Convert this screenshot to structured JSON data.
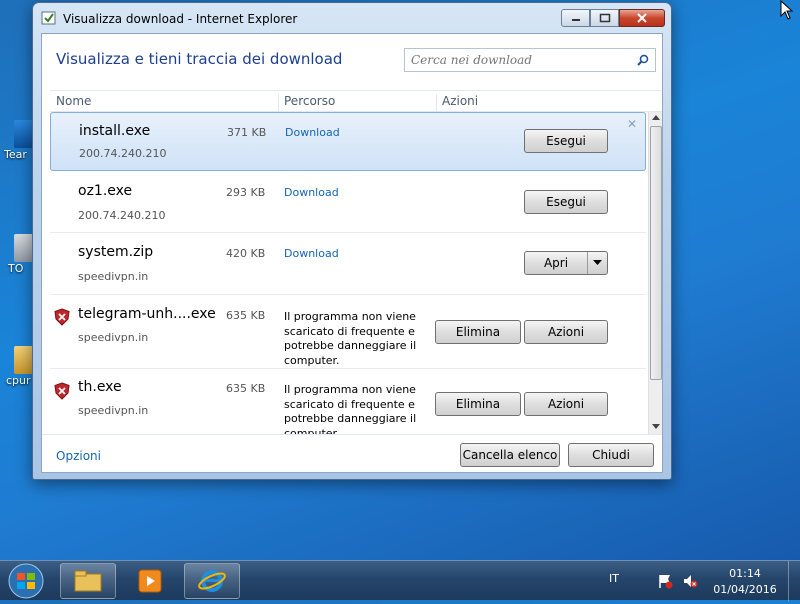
{
  "window": {
    "title": "Visualizza download - Internet Explorer"
  },
  "header": {
    "title": "Visualizza e tieni traccia dei download",
    "search_placeholder": "Cerca nei download"
  },
  "columns": [
    "Nome",
    "Percorso",
    "Azioni"
  ],
  "downloads": [
    {
      "name": "install.exe",
      "source": "200.74.240.210",
      "size": "371 KB",
      "location": "Download",
      "action": "Esegui"
    },
    {
      "name": "oz1.exe",
      "source": "200.74.240.210",
      "size": "293 KB",
      "location": "Download",
      "action": "Esegui"
    },
    {
      "name": "system.zip",
      "source": "speedivpn.in",
      "size": "420 KB",
      "location": "Download",
      "action": "Apri"
    },
    {
      "name": "telegram-unh....exe",
      "source": "speedivpn.in",
      "size": "635 KB",
      "warning": "Il programma non viene scaricato di frequente e potrebbe danneggiare il computer.",
      "delete": "Elimina",
      "actions": "Azioni"
    },
    {
      "name": "th.exe",
      "source": "speedivpn.in",
      "size": "635 KB",
      "warning": "Il programma non viene scaricato di frequente e potrebbe danneggiare il computer.",
      "delete": "Elimina",
      "actions": "Azioni"
    }
  ],
  "footer": {
    "options": "Opzioni",
    "clear_list": "Cancella elenco",
    "close": "Chiudi"
  },
  "desktop_icons": [
    "Tear",
    "TO",
    "cpur"
  ],
  "taskbar": {
    "language": "IT",
    "time": "01:14",
    "date": "01/04/2016"
  }
}
